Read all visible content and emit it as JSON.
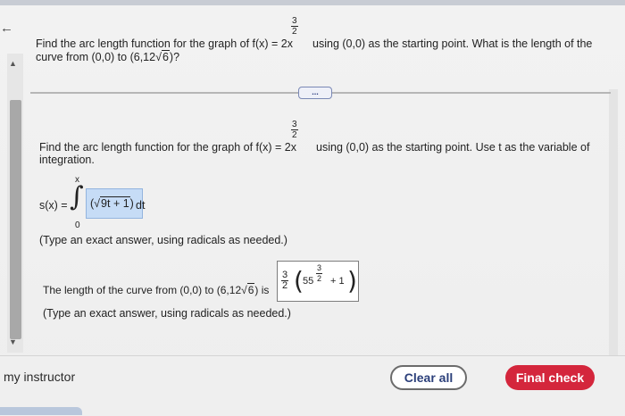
{
  "question_header": {
    "line1_prefix": "Find the arc length function for the graph of f(x) = 2x",
    "exp_num": "3",
    "exp_den": "2",
    "line1_suffix": "using (0,0) as the starting point. What is the length of the",
    "line2_prefix": "curve from (0,0) to (6,12",
    "line2_sqrt": "6",
    "line2_suffix": ")?"
  },
  "more_button": "...",
  "part1": {
    "line1_prefix": "Find the arc length function for the graph of f(x) = 2x",
    "exp_num": "3",
    "exp_den": "2",
    "line1_suffix": "using (0,0) as the starting point. Use t as the variable of",
    "line2": "integration.",
    "s_label": "s(x) =",
    "upper_limit": "x",
    "lower_limit": "0",
    "integral_sign": "∫",
    "answer_prefix": "(",
    "answer_sqrt": "9t + 1",
    "answer_suffix": ")",
    "dt": "dt",
    "hint": "(Type an exact answer, using radicals as needed.)"
  },
  "part2": {
    "text_prefix": "The length of the curve from (0,0) to (6,12",
    "text_sqrt": "6",
    "text_suffix": ") is",
    "frac_num": "3",
    "frac_den": "2",
    "base": "55",
    "exp_num": "3",
    "exp_den": "2",
    "plus_one": "+ 1",
    "paren_l": "(",
    "paren_r": ")",
    "hint": "(Type an exact answer, using radicals as needed.)"
  },
  "footer": {
    "instructor": "my instructor",
    "clear_all": "Clear all",
    "final_check": "Final check"
  },
  "icons": {
    "back": "back-arrow-icon",
    "scroll_up": "scroll-up-icon",
    "scroll_down": "scroll-down-icon"
  },
  "colors": {
    "final_check_bg": "#d4263c",
    "answer_highlight": "#c6dcf6",
    "link_blue": "#2b3f7a"
  }
}
